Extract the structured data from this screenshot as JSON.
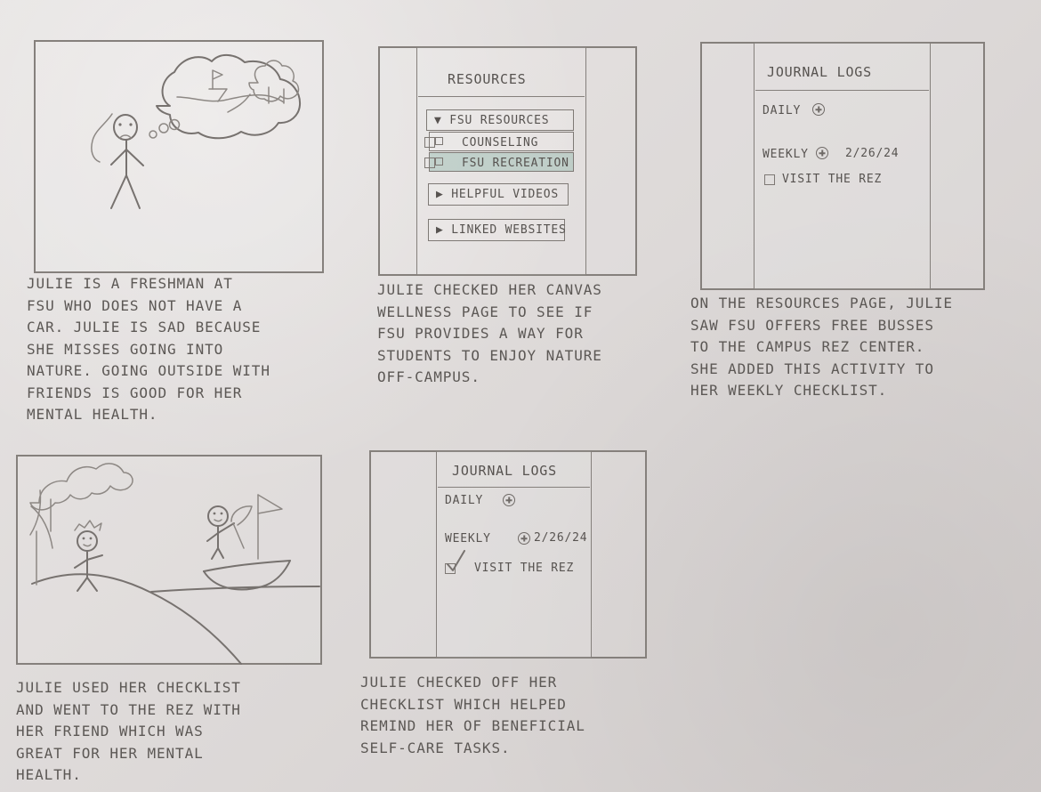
{
  "panels": {
    "panel1": {
      "caption": "JULIE IS A FRESHMAN AT\nFSU WHO DOES NOT HAVE A\nCAR. JULIE IS SAD BECAUSE\nSHE MISSES GOING INTO\nNATURE. GOING OUTSIDE WITH\nFRIENDS IS GOOD FOR HER\nMENTAL HEALTH."
    },
    "panel2": {
      "title": "RESOURCES",
      "buttons": {
        "fsu_resources": "▼ FSU RESOURCES",
        "counseling": "COUNSELING",
        "fsu_recreation": "FSU RECREATION",
        "helpful_videos": "▶ HELPFUL VIDEOS",
        "linked_websites": "▶ LINKED WEBSITES"
      },
      "caption": "JULIE CHECKED HER CANVAS\nWELLNESS PAGE TO SEE IF\nFSU PROVIDES A WAY FOR\nSTUDENTS TO ENJOY NATURE\nOFF-CAMPUS."
    },
    "panel3": {
      "title": "JOURNAL LOGS",
      "daily": "DAILY",
      "weekly": "WEEKLY",
      "date": "2/26/24",
      "task": "VISIT THE REZ",
      "caption": "ON THE RESOURCES PAGE, JULIE\nSAW FSU OFFERS FREE BUSSES\nTO THE CAMPUS REZ CENTER.\nSHE ADDED THIS ACTIVITY TO\nHER WEEKLY CHECKLIST."
    },
    "panel4": {
      "caption": "JULIE USED HER CHECKLIST\nAND WENT TO THE REZ WITH\nHER FRIEND WHICH WAS\nGREAT FOR HER MENTAL\nHEALTH."
    },
    "panel5": {
      "title": "JOURNAL LOGS",
      "daily": "DAILY",
      "weekly": "WEEKLY",
      "date": "2/26/24",
      "task": "VISIT THE REZ",
      "caption": "JULIE CHECKED OFF HER\nCHECKLIST WHICH HELPED\nREMIND HER OF BENEFICIAL\nSELF-CARE TASKS."
    }
  }
}
